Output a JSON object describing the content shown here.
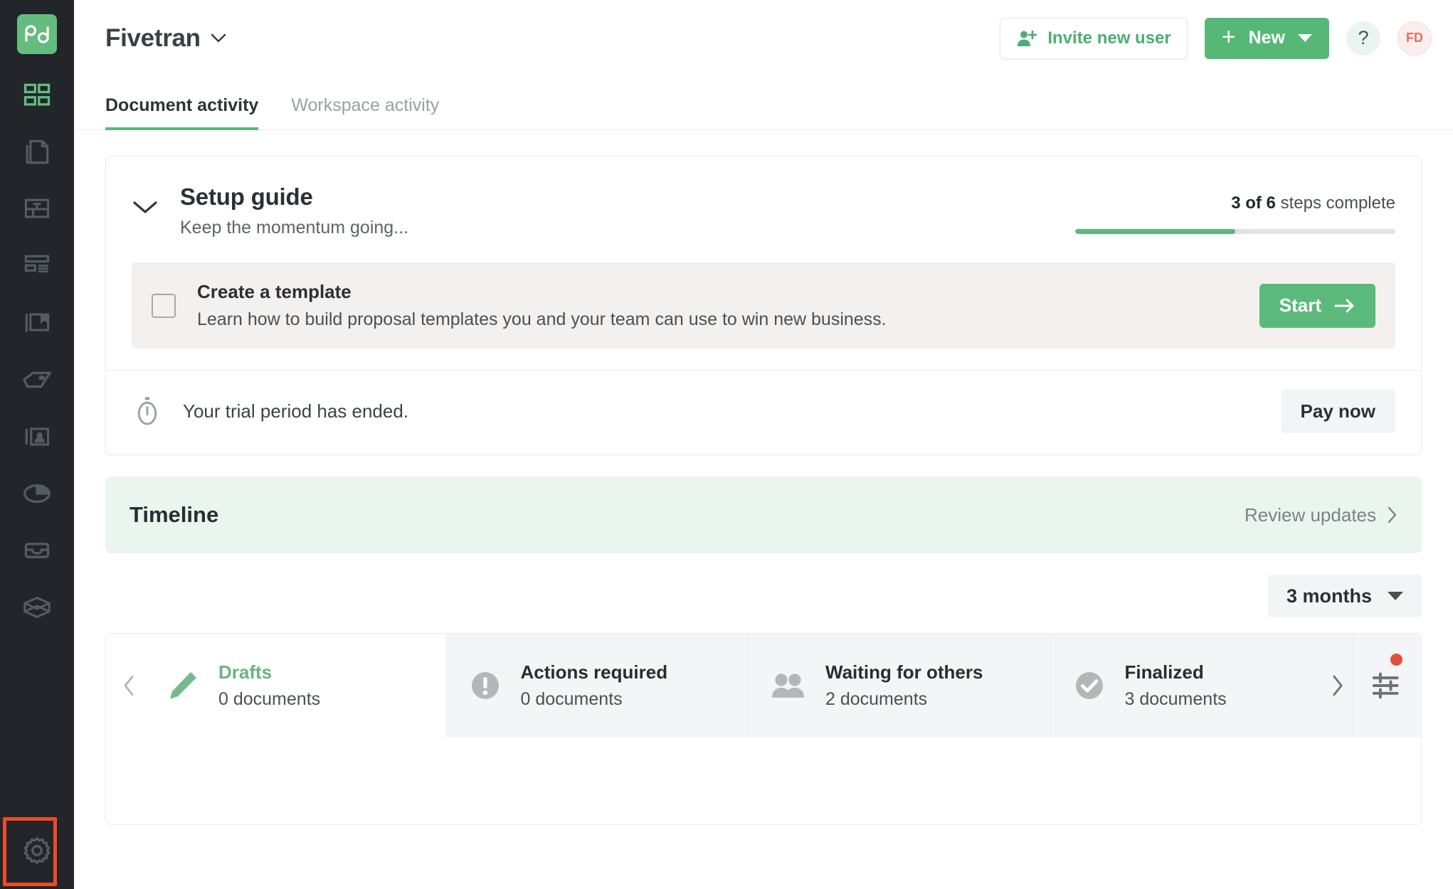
{
  "sidebar": {
    "logo": {
      "name": "pandadoc-logo",
      "alt": "pd"
    },
    "items": [
      {
        "icon": "grid-dashboard-icon",
        "name": "sidebar-item-dashboard",
        "active": true
      },
      {
        "icon": "documents-icon",
        "name": "sidebar-item-documents",
        "active": false
      },
      {
        "icon": "templates-icon",
        "name": "sidebar-item-templates",
        "active": false
      },
      {
        "icon": "content-library-icon",
        "name": "sidebar-item-content-library",
        "active": false
      },
      {
        "icon": "catalog-icon",
        "name": "sidebar-item-catalog",
        "active": false
      },
      {
        "icon": "pricing-tag-icon",
        "name": "sidebar-item-pricing",
        "active": false
      },
      {
        "icon": "contacts-icon",
        "name": "sidebar-item-contacts",
        "active": false
      },
      {
        "icon": "reports-pie-icon",
        "name": "sidebar-item-reports",
        "active": false
      },
      {
        "icon": "inbox-icon",
        "name": "sidebar-item-inbox",
        "active": false
      },
      {
        "icon": "integrations-box-icon",
        "name": "sidebar-item-integrations",
        "active": false
      }
    ],
    "settings": {
      "icon": "gear-icon",
      "name": "sidebar-item-settings",
      "highlighted": true,
      "highlight_color": "#f04a26"
    }
  },
  "header": {
    "workspace_name": "Fivetran",
    "invite_label": "Invite new user",
    "new_label": "New",
    "help_label": "?",
    "avatar_initials": "FD",
    "accent_green": "#56b877",
    "invite_text_color": "#4caf72",
    "avatar_color": "#ef6b5e"
  },
  "tabs": [
    {
      "label": "Document activity",
      "active": true
    },
    {
      "label": "Workspace activity",
      "active": false
    }
  ],
  "setup_guide": {
    "title": "Setup guide",
    "subtitle": "Keep the momentum going...",
    "steps_bold": "3 of 6",
    "steps_rest": " steps complete",
    "progress_percent": 50,
    "task": {
      "title": "Create a template",
      "description": "Learn how to build proposal templates you and your team can use to win new business.",
      "start_label": "Start",
      "checked": false
    },
    "trial": {
      "message": "Your trial period has ended.",
      "pay_label": "Pay now"
    }
  },
  "timeline": {
    "title": "Timeline",
    "review_label": "Review updates"
  },
  "range_selector": {
    "value": "3 months"
  },
  "status_strip": {
    "cells": [
      {
        "label": "Drafts",
        "count": "0 documents",
        "icon": "pencil-icon",
        "active": true
      },
      {
        "label": "Actions required",
        "count": "0 documents",
        "icon": "exclamation-circle-icon",
        "active": false
      },
      {
        "label": "Waiting for others",
        "count": "2 documents",
        "icon": "people-icon",
        "active": false
      },
      {
        "label": "Finalized",
        "count": "3 documents",
        "icon": "check-circle-icon",
        "active": false
      }
    ],
    "filter_icon": "filter-sliders-icon",
    "filter_badge_color": "#e04f3d"
  }
}
